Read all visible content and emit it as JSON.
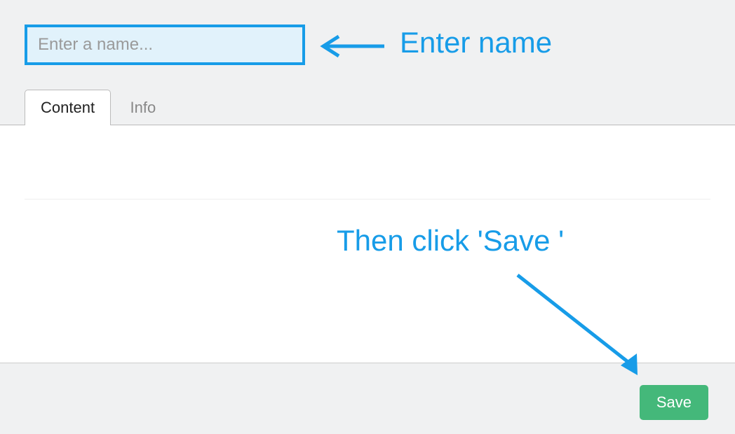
{
  "nameInput": {
    "placeholder": "Enter a name...",
    "value": ""
  },
  "tabs": [
    {
      "label": "Content",
      "active": true
    },
    {
      "label": "Info",
      "active": false
    }
  ],
  "saveButton": {
    "label": "Save"
  },
  "annotations": {
    "enterName": "Enter name",
    "thenClickSave": "Then click 'Save '"
  },
  "colors": {
    "highlight": "#179ce8",
    "saveButton": "#44b87a",
    "inputBg": "#e1f2fb"
  }
}
